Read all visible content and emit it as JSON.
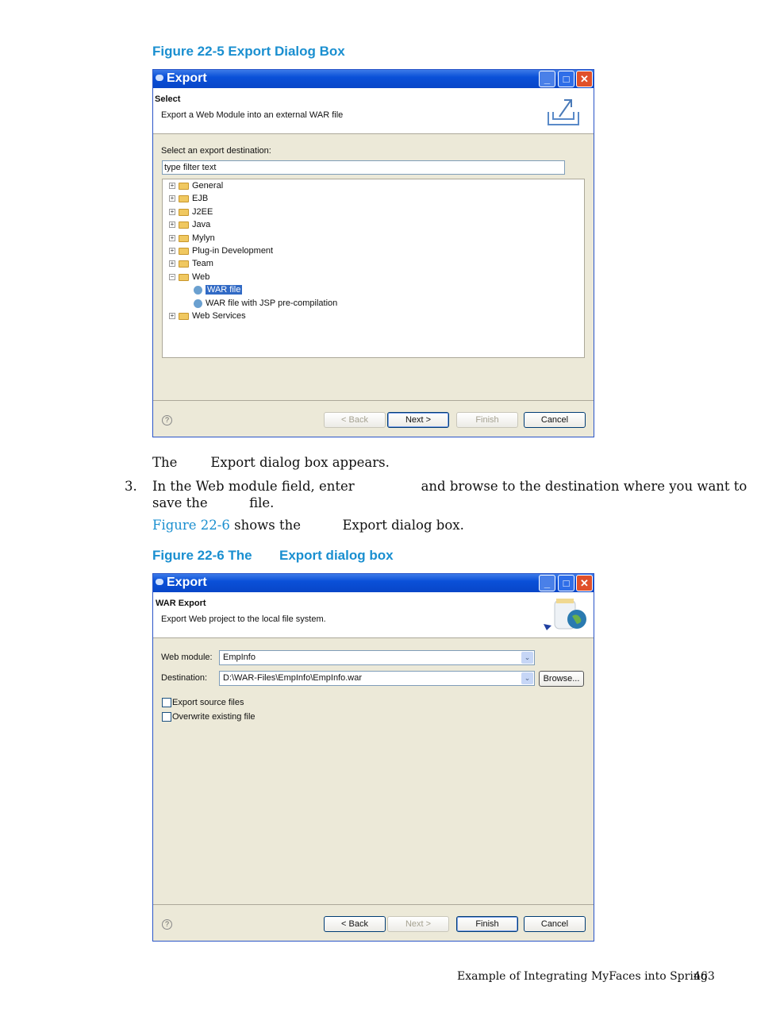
{
  "figure1": {
    "caption": "Figure 22-5 Export Dialog Box",
    "dialog": {
      "title": "Export",
      "header_title": "Select",
      "header_desc": "Export a Web Module into an external WAR file",
      "filter_label": "Select an export destination:",
      "filter_value": "type filter text",
      "tree": [
        {
          "label": "General",
          "type": "folder",
          "expanded": false
        },
        {
          "label": "EJB",
          "type": "folder",
          "expanded": false
        },
        {
          "label": "J2EE",
          "type": "folder",
          "expanded": false
        },
        {
          "label": "Java",
          "type": "folder",
          "expanded": false
        },
        {
          "label": "Mylyn",
          "type": "folder",
          "expanded": false
        },
        {
          "label": "Plug-in Development",
          "type": "folder",
          "expanded": false
        },
        {
          "label": "Team",
          "type": "folder",
          "expanded": false
        },
        {
          "label": "Web",
          "type": "folder",
          "expanded": true
        },
        {
          "label": "WAR file",
          "type": "leaf",
          "selected": true
        },
        {
          "label": "WAR file with JSP pre-compilation",
          "type": "leaf"
        },
        {
          "label": "Web Services",
          "type": "folder",
          "expanded": false
        }
      ],
      "buttons": {
        "back": "< Back",
        "next": "Next >",
        "finish": "Finish",
        "cancel": "Cancel"
      },
      "help": "?"
    }
  },
  "para1": "The        Export dialog box appears.",
  "step3": {
    "num": "3.",
    "line1": "In the Web module field, enter                and browse to the destination where you want to",
    "line2": "save the          file."
  },
  "para2": {
    "link": "Figure 22-6",
    "rest": " shows the          Export dialog box."
  },
  "figure2": {
    "caption_a": "Figure 22-6 The",
    "caption_b": "Export dialog box",
    "dialog": {
      "title": "Export",
      "header_title": "WAR Export",
      "header_desc": "Export Web project to the local file system.",
      "web_module_label": "Web module:",
      "web_module_value": "EmpInfo",
      "destination_label": "Destination:",
      "destination_value": "D:\\WAR-Files\\EmpInfo\\EmpInfo.war",
      "browse": "Browse...",
      "export_source": {
        "label": "Export source files",
        "checked": false
      },
      "overwrite": {
        "label": "Overwrite existing file",
        "checked": false
      },
      "buttons": {
        "back": "< Back",
        "next": "Next >",
        "finish": "Finish",
        "cancel": "Cancel"
      },
      "help": "?"
    }
  },
  "footer": {
    "title": "Example of Integrating MyFaces into Spring",
    "page": "463"
  },
  "colors": {
    "caption": "#1a8fd0",
    "titlebar": "#0a50d8",
    "dialog_bg": "#ece9d8",
    "selection": "#316ac5"
  }
}
